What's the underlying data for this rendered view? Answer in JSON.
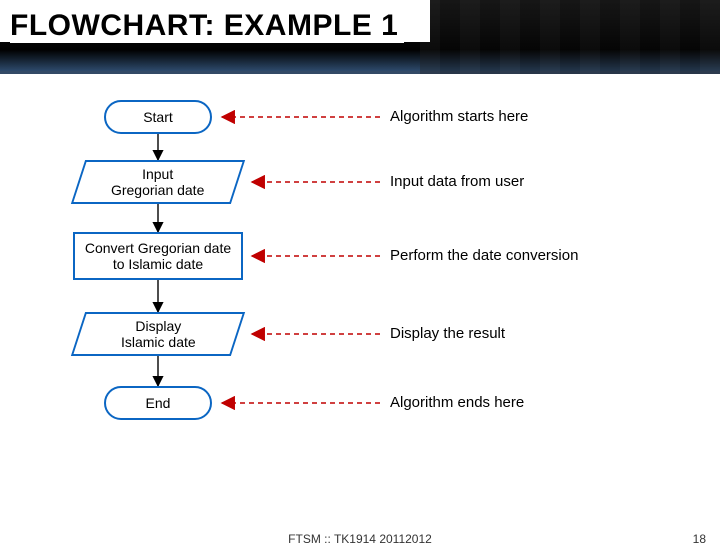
{
  "title": "FLOWCHART: EXAMPLE 1",
  "nodes": {
    "start": "Start",
    "input": "Input\nGregorian date",
    "convert": "Convert Gregorian date to Islamic date",
    "display": "Display\nIslamic date",
    "end": "End"
  },
  "annotations": {
    "start": "Algorithm starts here",
    "input": "Input data from user",
    "convert": "Perform the date conversion",
    "display": "Display the result",
    "end": "Algorithm ends here"
  },
  "footer": {
    "center": "FTSM :: TK1914 20112012",
    "page": "18"
  }
}
